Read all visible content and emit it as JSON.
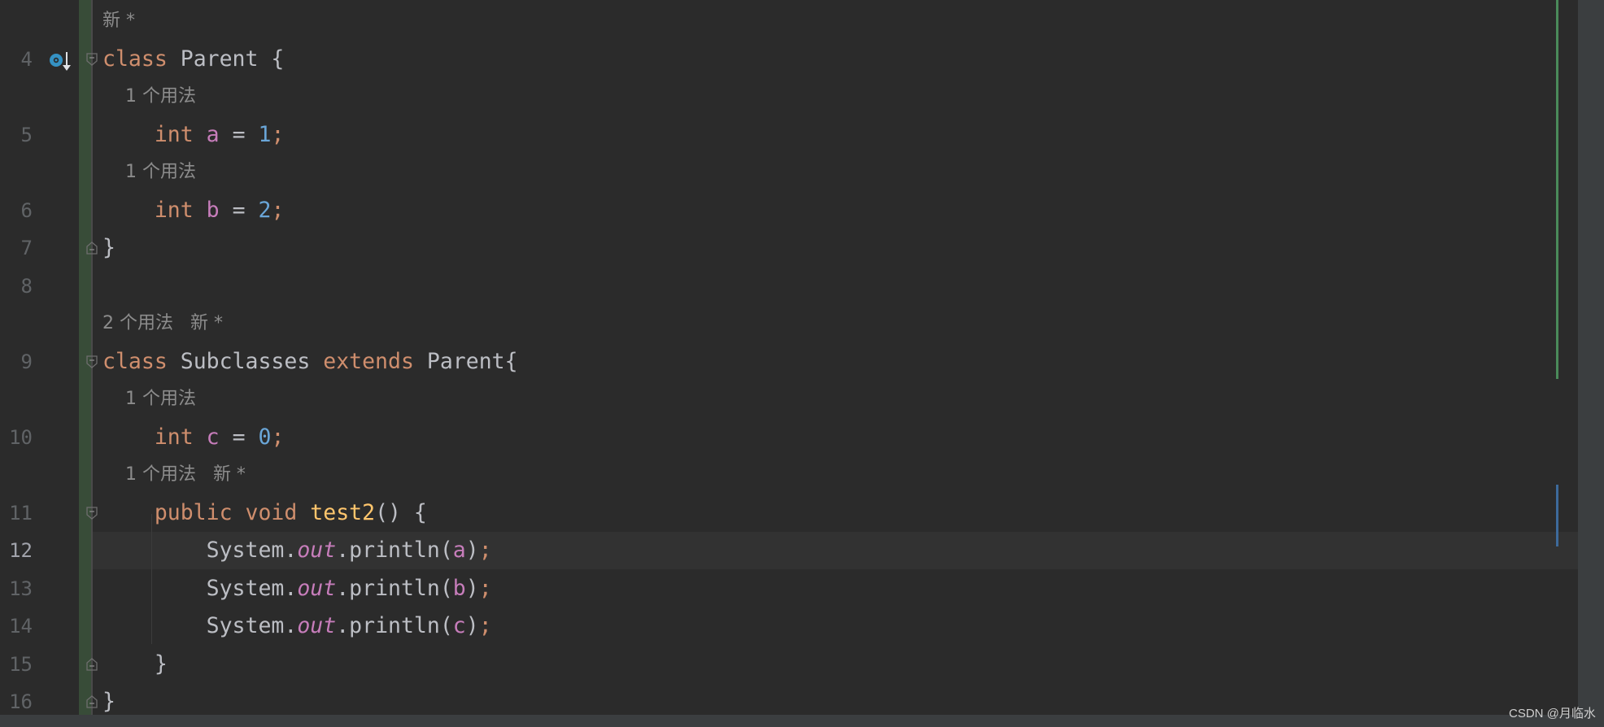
{
  "rows": [
    {
      "hint": "新 *"
    },
    {
      "ln": "4",
      "tokens": [
        [
          "class ",
          "kw"
        ],
        [
          "Parent {",
          "id"
        ]
      ],
      "fold": "open"
    },
    {
      "hint": "    1 个用法"
    },
    {
      "ln": "5",
      "tokens": [
        [
          "    int ",
          "kw"
        ],
        [
          "a",
          "fld"
        ],
        [
          " = ",
          "id"
        ],
        [
          "1",
          "num"
        ],
        [
          ";",
          "semi"
        ]
      ]
    },
    {
      "hint": "    1 个用法"
    },
    {
      "ln": "6",
      "tokens": [
        [
          "    int ",
          "kw"
        ],
        [
          "b",
          "fld"
        ],
        [
          " = ",
          "id"
        ],
        [
          "2",
          "num"
        ],
        [
          ";",
          "semi"
        ]
      ]
    },
    {
      "ln": "7",
      "tokens": [
        [
          "}",
          "id"
        ]
      ],
      "fold": "close"
    },
    {
      "ln": "8",
      "tokens": []
    },
    {
      "hint": "2 个用法   新 *"
    },
    {
      "ln": "9",
      "tokens": [
        [
          "class ",
          "kw"
        ],
        [
          "Subclasses ",
          "id"
        ],
        [
          "extends ",
          "kw"
        ],
        [
          "Parent{",
          "id"
        ]
      ],
      "fold": "open"
    },
    {
      "hint": "    1 个用法"
    },
    {
      "ln": "10",
      "tokens": [
        [
          "    int ",
          "kw"
        ],
        [
          "c",
          "fld"
        ],
        [
          " = ",
          "id"
        ],
        [
          "0",
          "num"
        ],
        [
          ";",
          "semi"
        ]
      ]
    },
    {
      "hint": "    1 个用法   新 *"
    },
    {
      "ln": "11",
      "tokens": [
        [
          "    public void ",
          "kw"
        ],
        [
          "test2",
          "fn"
        ],
        [
          "() {",
          "id"
        ]
      ],
      "fold": "open"
    },
    {
      "ln": "12",
      "current": true,
      "tokens": [
        [
          "        System.",
          "id"
        ],
        [
          "out",
          "st"
        ],
        [
          ".println(",
          "id"
        ],
        [
          "a",
          "fld"
        ],
        [
          ")",
          "id"
        ],
        [
          ";",
          "semi"
        ]
      ]
    },
    {
      "ln": "13",
      "tokens": [
        [
          "        System.",
          "id"
        ],
        [
          "out",
          "st"
        ],
        [
          ".println(",
          "id"
        ],
        [
          "b",
          "fld"
        ],
        [
          ")",
          "id"
        ],
        [
          ";",
          "semi"
        ]
      ]
    },
    {
      "ln": "14",
      "tokens": [
        [
          "        System.",
          "id"
        ],
        [
          "out",
          "st"
        ],
        [
          ".println(",
          "id"
        ],
        [
          "c",
          "fld"
        ],
        [
          ")",
          "id"
        ],
        [
          ";",
          "semi"
        ]
      ]
    },
    {
      "ln": "15",
      "tokens": [
        [
          "    }",
          "id"
        ]
      ],
      "fold": "close"
    },
    {
      "ln": "16",
      "tokens": [
        [
          "}",
          "id"
        ]
      ],
      "fold": "close"
    }
  ],
  "watermark": "CSDN @月临水",
  "gutter_icon": "implemented-override-icon",
  "colors": {
    "keyword": "#cf8e6d",
    "field": "#c77dbb",
    "number": "#6aa6d8",
    "method": "#ffc66d",
    "background": "#2b2b2b"
  }
}
